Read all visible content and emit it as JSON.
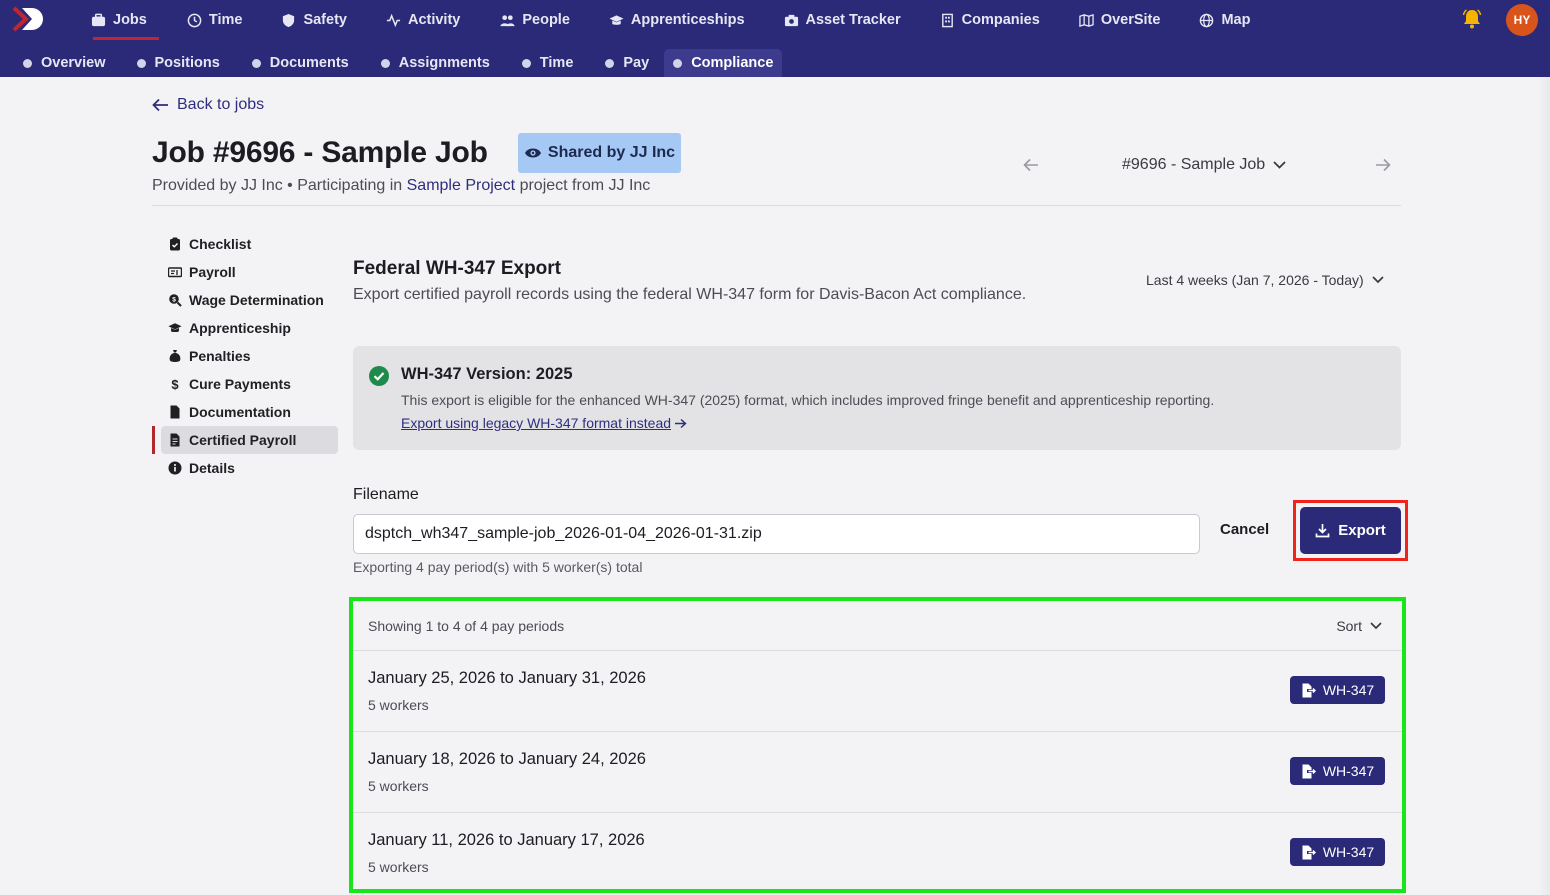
{
  "topnav": {
    "items": [
      {
        "label": "Jobs",
        "icon": "briefcase-icon",
        "active": true
      },
      {
        "label": "Time",
        "icon": "clock-icon"
      },
      {
        "label": "Safety",
        "icon": "shield-icon"
      },
      {
        "label": "Activity",
        "icon": "activity-icon"
      },
      {
        "label": "People",
        "icon": "people-icon"
      },
      {
        "label": "Apprenticeships",
        "icon": "graduation-cap-icon"
      },
      {
        "label": "Asset Tracker",
        "icon": "camera-icon"
      },
      {
        "label": "Companies",
        "icon": "building-icon"
      },
      {
        "label": "OverSite",
        "icon": "map-fold-icon"
      },
      {
        "label": "Map",
        "icon": "globe-icon"
      }
    ],
    "avatar_initials": "HY"
  },
  "subnav": {
    "items": [
      {
        "label": "Overview"
      },
      {
        "label": "Positions"
      },
      {
        "label": "Documents"
      },
      {
        "label": "Assignments"
      },
      {
        "label": "Time"
      },
      {
        "label": "Pay"
      },
      {
        "label": "Compliance",
        "active": true
      }
    ]
  },
  "header": {
    "back_label": "Back to jobs",
    "title": "Job #9696 - Sample Job",
    "shared_badge": "Shared by JJ Inc",
    "subtitle_prefix": "Provided by JJ Inc • Participating in",
    "subtitle_link": "Sample Project",
    "subtitle_suffix": "project from JJ Inc",
    "job_selector": "#9696 - Sample Job"
  },
  "sidebar": {
    "items": [
      {
        "label": "Checklist",
        "icon": "clipboard-check-icon"
      },
      {
        "label": "Payroll",
        "icon": "money-check-icon"
      },
      {
        "label": "Wage Determination",
        "icon": "magnifier-dollar-icon"
      },
      {
        "label": "Apprenticeship",
        "icon": "graduation-cap-icon"
      },
      {
        "label": "Penalties",
        "icon": "money-bag-icon"
      },
      {
        "label": "Cure Payments",
        "icon": "dollar-sign-icon"
      },
      {
        "label": "Documentation",
        "icon": "file-icon"
      },
      {
        "label": "Certified Payroll",
        "icon": "file-certified-icon",
        "active": true
      },
      {
        "label": "Details",
        "icon": "info-circle-icon"
      }
    ]
  },
  "main": {
    "title": "Federal WH-347 Export",
    "description": "Export certified payroll records using the federal WH-347 form for Davis-Bacon Act compliance.",
    "date_range": "Last 4 weeks (Jan 7, 2026 - Today)",
    "info": {
      "heading": "WH-347 Version: 2025",
      "text": "This export is eligible for the enhanced WH-347 (2025) format, which includes improved fringe benefit and apprenticeship reporting.",
      "link": "Export using legacy WH-347 format instead"
    },
    "filename_label": "Filename",
    "filename_value": "dsptch_wh347_sample-job_2026-01-04_2026-01-31.zip",
    "filename_help": "Exporting 4 pay period(s) with 5 worker(s) total",
    "cancel_label": "Cancel",
    "export_label": "Export"
  },
  "periods": {
    "showing": "Showing 1 to 4 of 4 pay periods",
    "sort_label": "Sort",
    "rows": [
      {
        "range": "January 25, 2026 to January 31, 2026",
        "workers": "5 workers",
        "button": "WH-347"
      },
      {
        "range": "January 18, 2026 to January 24, 2026",
        "workers": "5 workers",
        "button": "WH-347"
      },
      {
        "range": "January 11, 2026 to January 17, 2026",
        "workers": "5 workers",
        "button": "WH-347"
      }
    ]
  },
  "colors": {
    "nav_bg": "#2b2a78",
    "accent_red": "#c0262d",
    "highlight_red": "#f2231b",
    "highlight_green": "#19e619",
    "success_green": "#1f8a4c",
    "badge_blue": "#a5c8f5"
  }
}
